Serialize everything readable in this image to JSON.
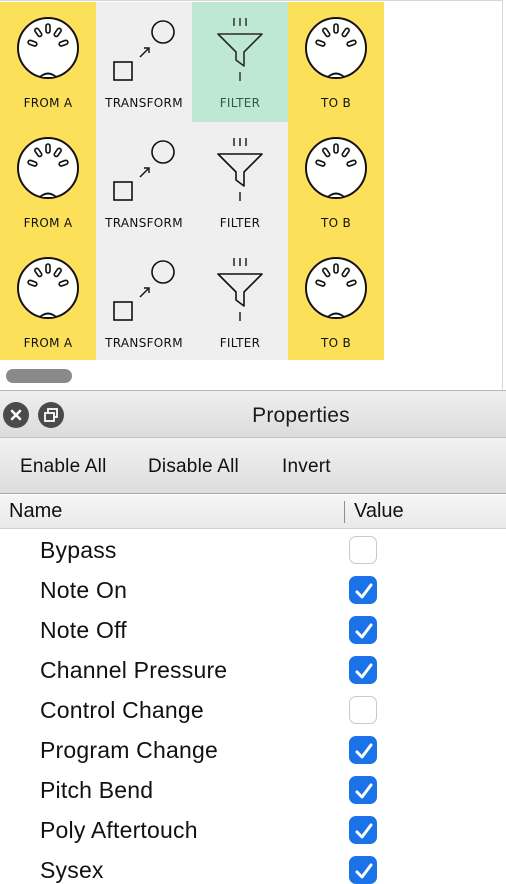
{
  "routing_grid": {
    "rows": [
      {
        "from_label": "FROM A",
        "transform_label": "TRANSFORM",
        "filter_label": "FILTER",
        "to_label": "TO B",
        "filter_selected": true
      },
      {
        "from_label": "FROM A",
        "transform_label": "TRANSFORM",
        "filter_label": "FILTER",
        "to_label": "TO B",
        "filter_selected": false
      },
      {
        "from_label": "FROM A",
        "transform_label": "TRANSFORM",
        "filter_label": "FILTER",
        "to_label": "TO B",
        "filter_selected": false
      }
    ],
    "icons": {
      "from": "midi-din-connector-icon",
      "transform": "transform-icon",
      "filter": "funnel-filter-icon",
      "to": "midi-din-connector-icon"
    }
  },
  "panel": {
    "title": "Properties",
    "close_icon": "close-icon",
    "float_icon": "restore-window-icon"
  },
  "toolbar": {
    "enable_all": "Enable All",
    "disable_all": "Disable All",
    "invert": "Invert"
  },
  "table": {
    "col_name": "Name",
    "col_value": "Value",
    "rows": [
      {
        "name": "Bypass",
        "checked": false
      },
      {
        "name": "Note On",
        "checked": true
      },
      {
        "name": "Note Off",
        "checked": true
      },
      {
        "name": "Channel Pressure",
        "checked": true
      },
      {
        "name": "Control Change",
        "checked": false
      },
      {
        "name": "Program Change",
        "checked": true
      },
      {
        "name": "Pitch Bend",
        "checked": true
      },
      {
        "name": "Poly Aftertouch",
        "checked": true
      },
      {
        "name": "Sysex",
        "checked": true
      }
    ]
  },
  "colors": {
    "input_output_column": "#fde05a",
    "processor_column": "#efefef",
    "selected_cell": "#bfe8d4",
    "checkbox_checked": "#1a73e8"
  }
}
